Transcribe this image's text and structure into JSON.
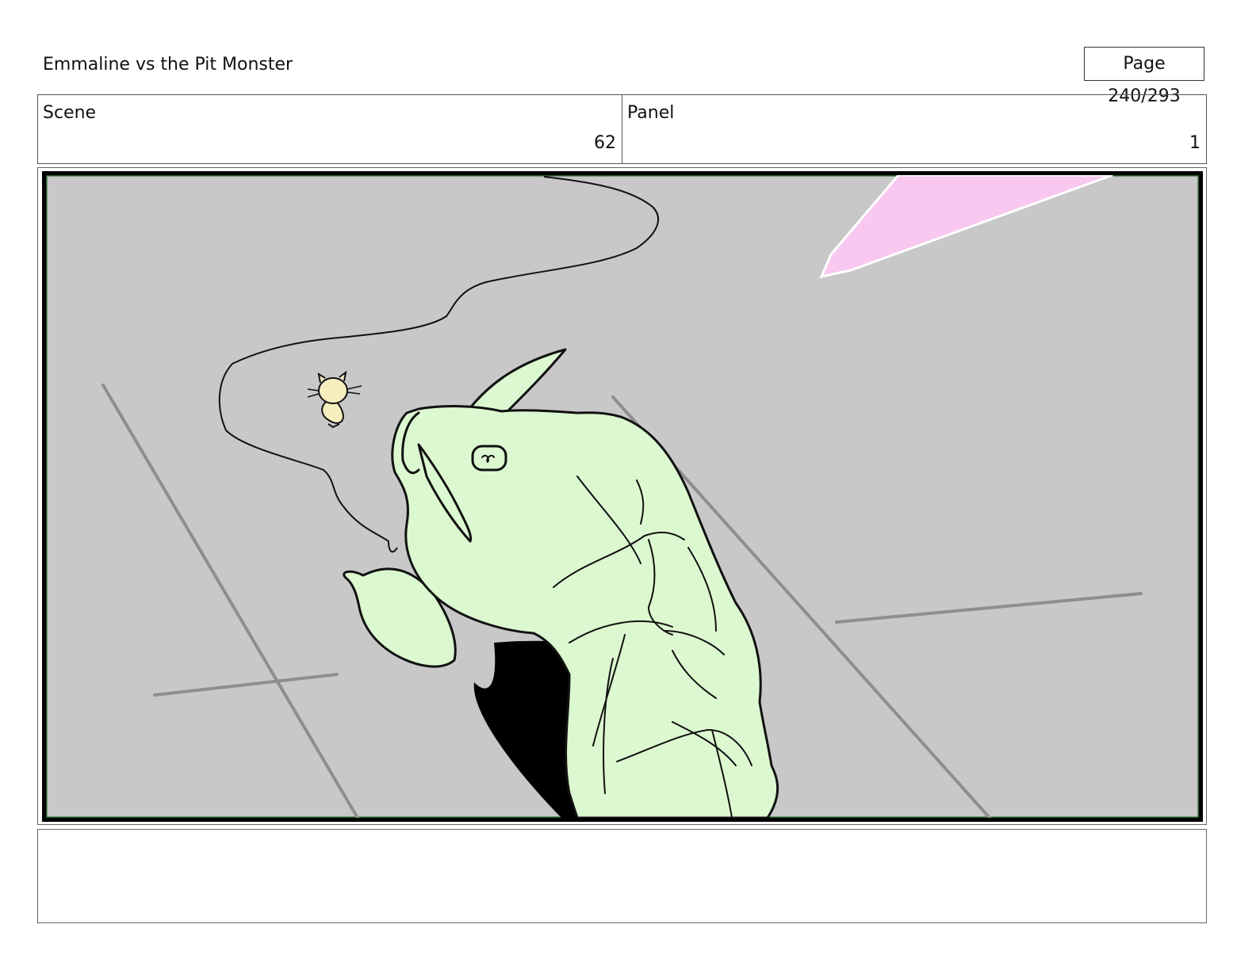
{
  "header": {
    "title": "Emmaline vs the Pit Monster",
    "page_label": "Page 240/293"
  },
  "scene": {
    "label": "Scene",
    "value": "62"
  },
  "panel": {
    "label": "Panel",
    "value": "1"
  },
  "artwork": {
    "colors": {
      "background": "#c8c8c8",
      "monster": "#dcf8d0",
      "hamster": "#f7eec0",
      "light_beam": "#f8c8f0",
      "frame_border": "#1d5a1d"
    }
  },
  "notes": {
    "text": ""
  }
}
